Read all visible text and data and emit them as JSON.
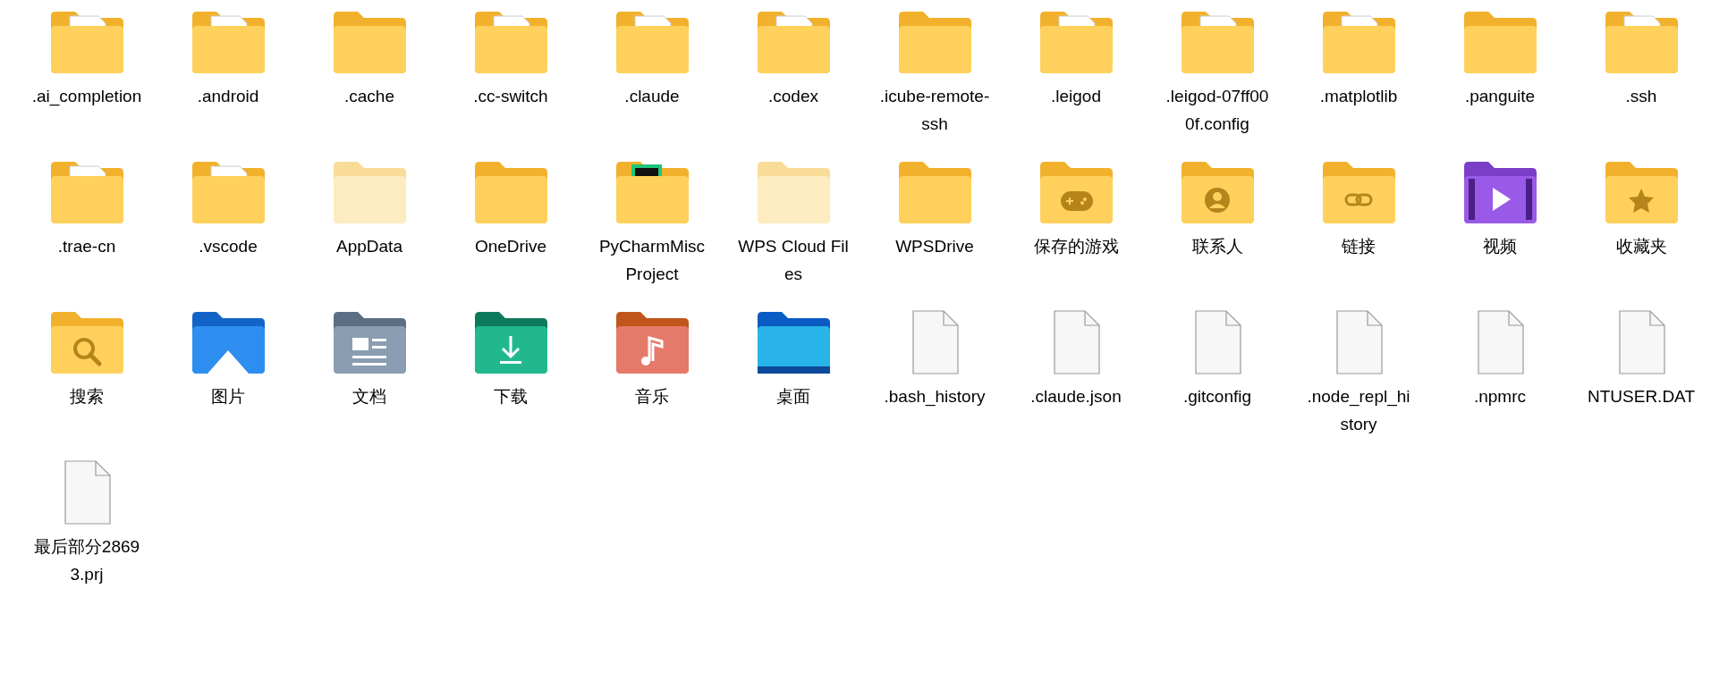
{
  "items": [
    {
      "name": ".ai_completion",
      "kind": "folder-doc"
    },
    {
      "name": ".android",
      "kind": "folder-doc"
    },
    {
      "name": ".cache",
      "kind": "folder"
    },
    {
      "name": ".cc-switch",
      "kind": "folder-doc"
    },
    {
      "name": ".claude",
      "kind": "folder-doc"
    },
    {
      "name": ".codex",
      "kind": "folder-doc"
    },
    {
      "name": ".icube-remote-ssh",
      "kind": "folder"
    },
    {
      "name": ".leigod",
      "kind": "folder-doc"
    },
    {
      "name": ".leigod-07ff000f.config",
      "kind": "folder-doc"
    },
    {
      "name": ".matplotlib",
      "kind": "folder-doc"
    },
    {
      "name": ".panguite",
      "kind": "folder"
    },
    {
      "name": ".ssh",
      "kind": "folder-doc"
    },
    {
      "name": ".trae-cn",
      "kind": "folder-doc"
    },
    {
      "name": ".vscode",
      "kind": "folder-doc"
    },
    {
      "name": "AppData",
      "kind": "folder-light"
    },
    {
      "name": "OneDrive",
      "kind": "folder"
    },
    {
      "name": "PyCharmMiscProject",
      "kind": "pycharm"
    },
    {
      "name": "WPS Cloud Files",
      "kind": "folder-light"
    },
    {
      "name": "WPSDrive",
      "kind": "folder"
    },
    {
      "name": "保存的游戏",
      "kind": "game"
    },
    {
      "name": "联系人",
      "kind": "contacts"
    },
    {
      "name": "链接",
      "kind": "link"
    },
    {
      "name": "视频",
      "kind": "video"
    },
    {
      "name": "收藏夹",
      "kind": "star"
    },
    {
      "name": "搜索",
      "kind": "search"
    },
    {
      "name": "图片",
      "kind": "pictures"
    },
    {
      "name": "文档",
      "kind": "documents"
    },
    {
      "name": "下载",
      "kind": "downloads"
    },
    {
      "name": "音乐",
      "kind": "music"
    },
    {
      "name": "桌面",
      "kind": "desktop"
    },
    {
      "name": ".bash_history",
      "kind": "file"
    },
    {
      "name": ".claude.json",
      "kind": "file"
    },
    {
      "name": ".gitconfig",
      "kind": "file"
    },
    {
      "name": ".node_repl_history",
      "kind": "file"
    },
    {
      "name": ".npmrc",
      "kind": "file"
    },
    {
      "name": "NTUSER.DAT",
      "kind": "file"
    },
    {
      "name": "最后部分28693.prj",
      "kind": "file"
    }
  ]
}
